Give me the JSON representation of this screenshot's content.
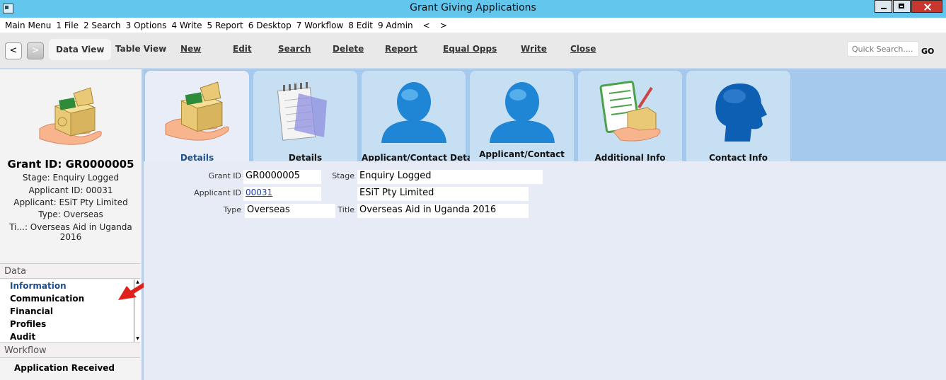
{
  "window": {
    "title": "Grant Giving Applications"
  },
  "menu": [
    "Main Menu",
    "1 File",
    "2 Search",
    "3 Options",
    "4 Write",
    "5 Report",
    "6 Desktop",
    "7 Workflow",
    "8 Edit",
    "9 Admin",
    "<",
    ">"
  ],
  "toolbar": {
    "back": "<",
    "forward": ">",
    "data_view": "Data View",
    "table_view": "Table View",
    "new": "New",
    "edit": "Edit",
    "search": "Search",
    "delete": "Delete",
    "report": "Report",
    "equal_opps": "Equal Opps",
    "write": "Write",
    "close": "Close",
    "quick_search_placeholder": "Quick Search....",
    "go": "GO"
  },
  "sidebar": {
    "grant_id": "Grant ID: GR0000005",
    "stage": "Stage: Enquiry Logged",
    "applicant_id": "Applicant ID: 00031",
    "applicant": "Applicant: ESiT Pty Limited",
    "type": "Type: Overseas",
    "title": "Ti...: Overseas Aid in Uganda 2016",
    "data_header": "Data",
    "data_items": [
      "Information",
      "Communication",
      "Financial",
      "Profiles",
      "Audit"
    ],
    "workflow_header": "Workflow",
    "workflow_item": "Application Received"
  },
  "tabs": [
    "Details",
    "Details",
    "Applicant/Contact Details",
    "Applicant/Contact",
    "Additional Info",
    "Contact Info"
  ],
  "form": {
    "grant_id_label": "Grant ID",
    "grant_id": "GR0000005",
    "stage_label": "Stage",
    "stage": "Enquiry Logged",
    "applicant_id_label": "Applicant ID",
    "applicant_id": "00031",
    "applicant_name": "ESiT Pty Limited",
    "type_label": "Type",
    "type": "Overseas",
    "title_label": "Title",
    "title": "Overseas Aid in Uganda 2016"
  },
  "icons": {
    "grant": "grant-box-hand-icon",
    "notepad": "notepad-icon",
    "person": "person-icon",
    "checklist": "checklist-icon",
    "head": "head-profile-icon",
    "arrow": "red-arrow-icon"
  },
  "colors": {
    "titlebar": "#62c6ed",
    "tabs_bg": "#a4c9ec",
    "tab": "#c7dff2",
    "content": "#e6ebf5",
    "accent": "#1d4f8d"
  }
}
